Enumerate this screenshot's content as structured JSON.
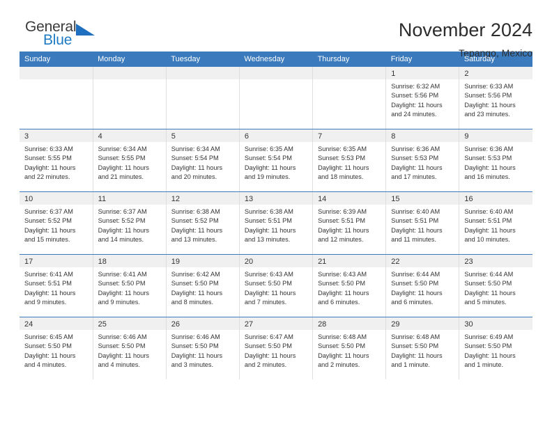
{
  "brand": {
    "name_top": "General",
    "name_bottom": "Blue",
    "accent_color": "#1f7ac4"
  },
  "header": {
    "title": "November 2024",
    "subtitle": "Tepango, Mexico"
  },
  "calendar": {
    "header_color": "#3a7abd",
    "weekday_headers": [
      "Sunday",
      "Monday",
      "Tuesday",
      "Wednesday",
      "Thursday",
      "Friday",
      "Saturday"
    ],
    "weeks": [
      [
        {
          "day": "",
          "lines": []
        },
        {
          "day": "",
          "lines": []
        },
        {
          "day": "",
          "lines": []
        },
        {
          "day": "",
          "lines": []
        },
        {
          "day": "",
          "lines": []
        },
        {
          "day": "1",
          "lines": [
            "Sunrise: 6:32 AM",
            "Sunset: 5:56 PM",
            "Daylight: 11 hours",
            "and 24 minutes."
          ]
        },
        {
          "day": "2",
          "lines": [
            "Sunrise: 6:33 AM",
            "Sunset: 5:56 PM",
            "Daylight: 11 hours",
            "and 23 minutes."
          ]
        }
      ],
      [
        {
          "day": "3",
          "lines": [
            "Sunrise: 6:33 AM",
            "Sunset: 5:55 PM",
            "Daylight: 11 hours",
            "and 22 minutes."
          ]
        },
        {
          "day": "4",
          "lines": [
            "Sunrise: 6:34 AM",
            "Sunset: 5:55 PM",
            "Daylight: 11 hours",
            "and 21 minutes."
          ]
        },
        {
          "day": "5",
          "lines": [
            "Sunrise: 6:34 AM",
            "Sunset: 5:54 PM",
            "Daylight: 11 hours",
            "and 20 minutes."
          ]
        },
        {
          "day": "6",
          "lines": [
            "Sunrise: 6:35 AM",
            "Sunset: 5:54 PM",
            "Daylight: 11 hours",
            "and 19 minutes."
          ]
        },
        {
          "day": "7",
          "lines": [
            "Sunrise: 6:35 AM",
            "Sunset: 5:53 PM",
            "Daylight: 11 hours",
            "and 18 minutes."
          ]
        },
        {
          "day": "8",
          "lines": [
            "Sunrise: 6:36 AM",
            "Sunset: 5:53 PM",
            "Daylight: 11 hours",
            "and 17 minutes."
          ]
        },
        {
          "day": "9",
          "lines": [
            "Sunrise: 6:36 AM",
            "Sunset: 5:53 PM",
            "Daylight: 11 hours",
            "and 16 minutes."
          ]
        }
      ],
      [
        {
          "day": "10",
          "lines": [
            "Sunrise: 6:37 AM",
            "Sunset: 5:52 PM",
            "Daylight: 11 hours",
            "and 15 minutes."
          ]
        },
        {
          "day": "11",
          "lines": [
            "Sunrise: 6:37 AM",
            "Sunset: 5:52 PM",
            "Daylight: 11 hours",
            "and 14 minutes."
          ]
        },
        {
          "day": "12",
          "lines": [
            "Sunrise: 6:38 AM",
            "Sunset: 5:52 PM",
            "Daylight: 11 hours",
            "and 13 minutes."
          ]
        },
        {
          "day": "13",
          "lines": [
            "Sunrise: 6:38 AM",
            "Sunset: 5:51 PM",
            "Daylight: 11 hours",
            "and 13 minutes."
          ]
        },
        {
          "day": "14",
          "lines": [
            "Sunrise: 6:39 AM",
            "Sunset: 5:51 PM",
            "Daylight: 11 hours",
            "and 12 minutes."
          ]
        },
        {
          "day": "15",
          "lines": [
            "Sunrise: 6:40 AM",
            "Sunset: 5:51 PM",
            "Daylight: 11 hours",
            "and 11 minutes."
          ]
        },
        {
          "day": "16",
          "lines": [
            "Sunrise: 6:40 AM",
            "Sunset: 5:51 PM",
            "Daylight: 11 hours",
            "and 10 minutes."
          ]
        }
      ],
      [
        {
          "day": "17",
          "lines": [
            "Sunrise: 6:41 AM",
            "Sunset: 5:51 PM",
            "Daylight: 11 hours",
            "and 9 minutes."
          ]
        },
        {
          "day": "18",
          "lines": [
            "Sunrise: 6:41 AM",
            "Sunset: 5:50 PM",
            "Daylight: 11 hours",
            "and 9 minutes."
          ]
        },
        {
          "day": "19",
          "lines": [
            "Sunrise: 6:42 AM",
            "Sunset: 5:50 PM",
            "Daylight: 11 hours",
            "and 8 minutes."
          ]
        },
        {
          "day": "20",
          "lines": [
            "Sunrise: 6:43 AM",
            "Sunset: 5:50 PM",
            "Daylight: 11 hours",
            "and 7 minutes."
          ]
        },
        {
          "day": "21",
          "lines": [
            "Sunrise: 6:43 AM",
            "Sunset: 5:50 PM",
            "Daylight: 11 hours",
            "and 6 minutes."
          ]
        },
        {
          "day": "22",
          "lines": [
            "Sunrise: 6:44 AM",
            "Sunset: 5:50 PM",
            "Daylight: 11 hours",
            "and 6 minutes."
          ]
        },
        {
          "day": "23",
          "lines": [
            "Sunrise: 6:44 AM",
            "Sunset: 5:50 PM",
            "Daylight: 11 hours",
            "and 5 minutes."
          ]
        }
      ],
      [
        {
          "day": "24",
          "lines": [
            "Sunrise: 6:45 AM",
            "Sunset: 5:50 PM",
            "Daylight: 11 hours",
            "and 4 minutes."
          ]
        },
        {
          "day": "25",
          "lines": [
            "Sunrise: 6:46 AM",
            "Sunset: 5:50 PM",
            "Daylight: 11 hours",
            "and 4 minutes."
          ]
        },
        {
          "day": "26",
          "lines": [
            "Sunrise: 6:46 AM",
            "Sunset: 5:50 PM",
            "Daylight: 11 hours",
            "and 3 minutes."
          ]
        },
        {
          "day": "27",
          "lines": [
            "Sunrise: 6:47 AM",
            "Sunset: 5:50 PM",
            "Daylight: 11 hours",
            "and 2 minutes."
          ]
        },
        {
          "day": "28",
          "lines": [
            "Sunrise: 6:48 AM",
            "Sunset: 5:50 PM",
            "Daylight: 11 hours",
            "and 2 minutes."
          ]
        },
        {
          "day": "29",
          "lines": [
            "Sunrise: 6:48 AM",
            "Sunset: 5:50 PM",
            "Daylight: 11 hours",
            "and 1 minute."
          ]
        },
        {
          "day": "30",
          "lines": [
            "Sunrise: 6:49 AM",
            "Sunset: 5:50 PM",
            "Daylight: 11 hours",
            "and 1 minute."
          ]
        }
      ]
    ]
  }
}
